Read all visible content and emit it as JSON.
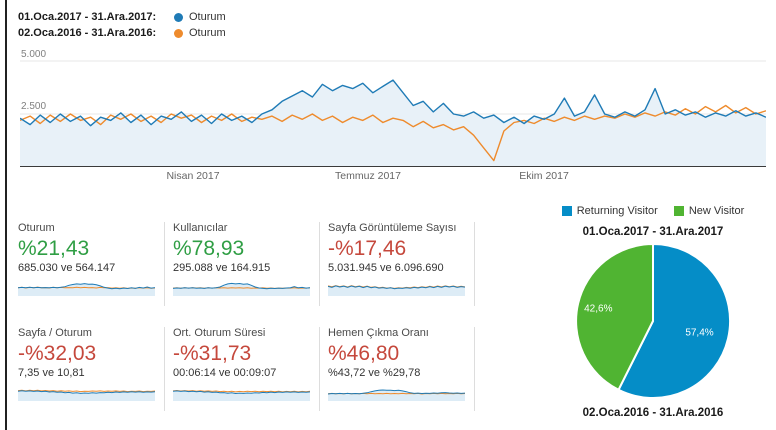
{
  "colors": {
    "series_2017_blue": "#1f7bb6",
    "series_2016_orange": "#ee8b2d",
    "area_fill": "#e8f1f8",
    "spark_fill": "#ddecf6",
    "pie_blue": "#058dc7",
    "pie_green": "#50b432",
    "positive_green": "#2f9e44",
    "negative_red": "#c5483c",
    "gridline": "#e7e7e7",
    "axis": "#3a3a3a"
  },
  "timeline_legend": {
    "row1": {
      "label": "01.Oca.2017 - 31.Ara.2017:",
      "metric": "Oturum"
    },
    "row2": {
      "label": "02.Oca.2016 - 31.Ara.2016:",
      "metric": "Oturum"
    }
  },
  "chart_data": [
    {
      "type": "line",
      "ylim": [
        0,
        5000
      ],
      "grid": true,
      "area_under_first_series": true,
      "y_ticks": [
        {
          "label": "5.000",
          "value": 5000
        },
        {
          "label": "2.500",
          "value": 2500
        }
      ],
      "x_ticks": [
        "Nisan 2017",
        "Temmuz 2017",
        "Ekim 2017"
      ],
      "series": [
        {
          "name": "01.Oca.2017 - 31.Ara.2017: Oturum",
          "color_key": "series_2017_blue",
          "values": [
            2300,
            2000,
            2450,
            2100,
            2500,
            2150,
            2400,
            1950,
            2350,
            2200,
            2550,
            2100,
            2450,
            2000,
            2400,
            2250,
            2600,
            2150,
            2450,
            2050,
            2500,
            2200,
            2400,
            2100,
            2500,
            2700,
            3100,
            3350,
            3600,
            3300,
            3900,
            3600,
            3850,
            3700,
            3950,
            3500,
            3800,
            4100,
            3500,
            2900,
            3100,
            2600,
            3000,
            2500,
            2400,
            2600,
            2300,
            2450,
            2100,
            2350,
            2050,
            2400,
            2250,
            2500,
            3250,
            2400,
            2600,
            3400,
            2500,
            2350,
            2600,
            2400,
            2700,
            3700,
            2500,
            2700,
            2450,
            2600,
            2350,
            2550,
            2400,
            2650,
            2400,
            2550,
            2350
          ]
        },
        {
          "name": "02.Oca.2016 - 31.Ara.2016: Oturum",
          "color_key": "series_2016_orange",
          "values": [
            2200,
            2400,
            2050,
            2450,
            2150,
            2500,
            2200,
            2350,
            2000,
            2450,
            2250,
            2500,
            2150,
            2400,
            2100,
            2500,
            2300,
            2450,
            2100,
            2400,
            2200,
            2500,
            2150,
            2350,
            2250,
            2400,
            2150,
            2450,
            2250,
            2500,
            2200,
            2400,
            2100,
            2350,
            2200,
            2450,
            2100,
            2300,
            2200,
            1900,
            2150,
            1850,
            2000,
            1750,
            1900,
            1500,
            900,
            300,
            1700,
            2100,
            2200,
            2050,
            2300,
            2150,
            2350,
            2200,
            2400,
            2250,
            2400,
            2300,
            2500,
            2350,
            2550,
            2400,
            2600,
            2450,
            2750,
            2500,
            2850,
            2600,
            2900,
            2550,
            2800,
            2500,
            2650
          ]
        }
      ]
    },
    {
      "type": "pie",
      "title": "01.Oca.2017 - 31.Ara.2017",
      "legend_position": "top",
      "slices": [
        {
          "label": "Returning Visitor",
          "value": 57.4,
          "display": "57,4%",
          "color_key": "pie_blue"
        },
        {
          "label": "New Visitor",
          "value": 42.6,
          "display": "42,6%",
          "color_key": "pie_green"
        }
      ],
      "footer_label": "02.Oca.2016 - 31.Ara.2016"
    }
  ],
  "cards": [
    {
      "title": "Oturum",
      "value": "%21,43",
      "trend": "positive",
      "subtitle": "685.030 ve 564.147",
      "spark": {
        "s2017": [
          45,
          47,
          44,
          48,
          45,
          47,
          44,
          46,
          45,
          47,
          44,
          48,
          52,
          62,
          68,
          72,
          70,
          74,
          69,
          71,
          66,
          58,
          48,
          42,
          38,
          41,
          37,
          42,
          39,
          44,
          40,
          47,
          43,
          50,
          42,
          46
        ],
        "s2016": [
          44,
          48,
          43,
          47,
          45,
          49,
          44,
          46,
          43,
          48,
          45,
          47,
          44,
          46,
          45,
          48,
          44,
          47,
          45,
          46,
          43,
          47,
          44,
          46,
          42,
          45,
          41,
          44,
          40,
          43,
          41,
          44,
          42,
          45,
          41,
          43
        ]
      }
    },
    {
      "title": "Kullanıcılar",
      "value": "%78,93",
      "trend": "positive",
      "subtitle": "295.088 ve 164.915",
      "spark": {
        "s2017": [
          40,
          43,
          41,
          44,
          42,
          44,
          41,
          43,
          40,
          44,
          42,
          45,
          50,
          63,
          72,
          76,
          72,
          75,
          70,
          72,
          62,
          50,
          43,
          40,
          38,
          41,
          39,
          42,
          40,
          43,
          45,
          52,
          44,
          47,
          42,
          45
        ],
        "s2016": [
          42,
          45,
          41,
          44,
          42,
          45,
          43,
          44,
          41,
          44,
          42,
          44,
          43,
          45,
          42,
          44,
          43,
          45,
          42,
          44,
          41,
          43,
          42,
          44,
          41,
          43,
          40,
          42,
          41,
          43,
          42,
          44,
          41,
          43,
          42,
          44
        ]
      }
    },
    {
      "title": "Sayfa Görüntüleme Sayısı",
      "value": "-%17,46",
      "trend": "negative",
      "subtitle": "5.031.945 ve 6.096.690",
      "spark": {
        "s2017": [
          55,
          48,
          58,
          50,
          56,
          47,
          57,
          49,
          55,
          46,
          54,
          45,
          50,
          42,
          46,
          40,
          44,
          38,
          42,
          40,
          45,
          41,
          47,
          43,
          49,
          44,
          52,
          46,
          54,
          48,
          56,
          50,
          55,
          47,
          53,
          49
        ],
        "s2016": [
          58,
          52,
          60,
          53,
          58,
          50,
          59,
          52,
          57,
          50,
          56,
          48,
          52,
          45,
          48,
          42,
          45,
          40,
          44,
          42,
          47,
          44,
          50,
          46,
          52,
          47,
          55,
          49,
          57,
          51,
          58,
          52,
          57,
          50,
          55,
          51
        ]
      }
    },
    {
      "title": "Sayfa / Oturum",
      "value": "-%32,03",
      "trend": "negative",
      "subtitle": "7,35 ve 10,81",
      "spark": {
        "s2017": [
          56,
          59,
          55,
          58,
          54,
          57,
          53,
          55,
          50,
          53,
          48,
          50,
          45,
          47,
          42,
          45,
          40,
          43,
          41,
          44,
          42,
          46,
          44,
          48,
          46,
          50,
          47,
          51,
          48,
          52,
          49,
          52,
          48,
          51,
          49,
          52
        ],
        "s2016": [
          60,
          63,
          58,
          62,
          59,
          62,
          58,
          61,
          57,
          60,
          56,
          59,
          55,
          58,
          54,
          57,
          53,
          56,
          54,
          57,
          55,
          58,
          54,
          57,
          55,
          58,
          54,
          57,
          53,
          56,
          54,
          57,
          53,
          56,
          54,
          57
        ]
      }
    },
    {
      "title": "Ort. Oturum Süresi",
      "value": "-%31,73",
      "trend": "negative",
      "subtitle": "00:06:14 ve 00:09:07",
      "spark": {
        "s2017": [
          55,
          58,
          54,
          57,
          53,
          56,
          52,
          54,
          49,
          52,
          47,
          49,
          44,
          46,
          41,
          44,
          39,
          42,
          40,
          43,
          41,
          45,
          43,
          47,
          45,
          49,
          46,
          50,
          47,
          51,
          48,
          51,
          47,
          50,
          48,
          51
        ],
        "s2016": [
          58,
          61,
          57,
          60,
          57,
          60,
          56,
          59,
          55,
          58,
          54,
          57,
          53,
          56,
          52,
          55,
          51,
          54,
          52,
          55,
          53,
          56,
          52,
          55,
          53,
          56,
          52,
          55,
          51,
          54,
          52,
          55,
          51,
          54,
          52,
          55
        ]
      }
    },
    {
      "title": "Hemen Çıkma Oranı",
      "value": "%46,80",
      "trend": "negative",
      "subtitle": "%43,72 ve %29,78",
      "spark": {
        "s2017": [
          36,
          39,
          37,
          40,
          38,
          40,
          37,
          39,
          38,
          41,
          44,
          52,
          58,
          62,
          64,
          62,
          63,
          60,
          62,
          58,
          52,
          44,
          40,
          42,
          39,
          41,
          40,
          43,
          41,
          44,
          46,
          43,
          41,
          43,
          40,
          42
        ],
        "s2016": [
          38,
          40,
          37,
          39,
          38,
          40,
          37,
          39,
          37,
          40,
          38,
          40,
          37,
          39,
          38,
          40,
          37,
          39,
          38,
          40,
          37,
          39,
          38,
          40,
          36,
          39,
          37,
          40,
          38,
          40,
          37,
          39,
          38,
          40,
          37,
          39
        ]
      }
    }
  ]
}
